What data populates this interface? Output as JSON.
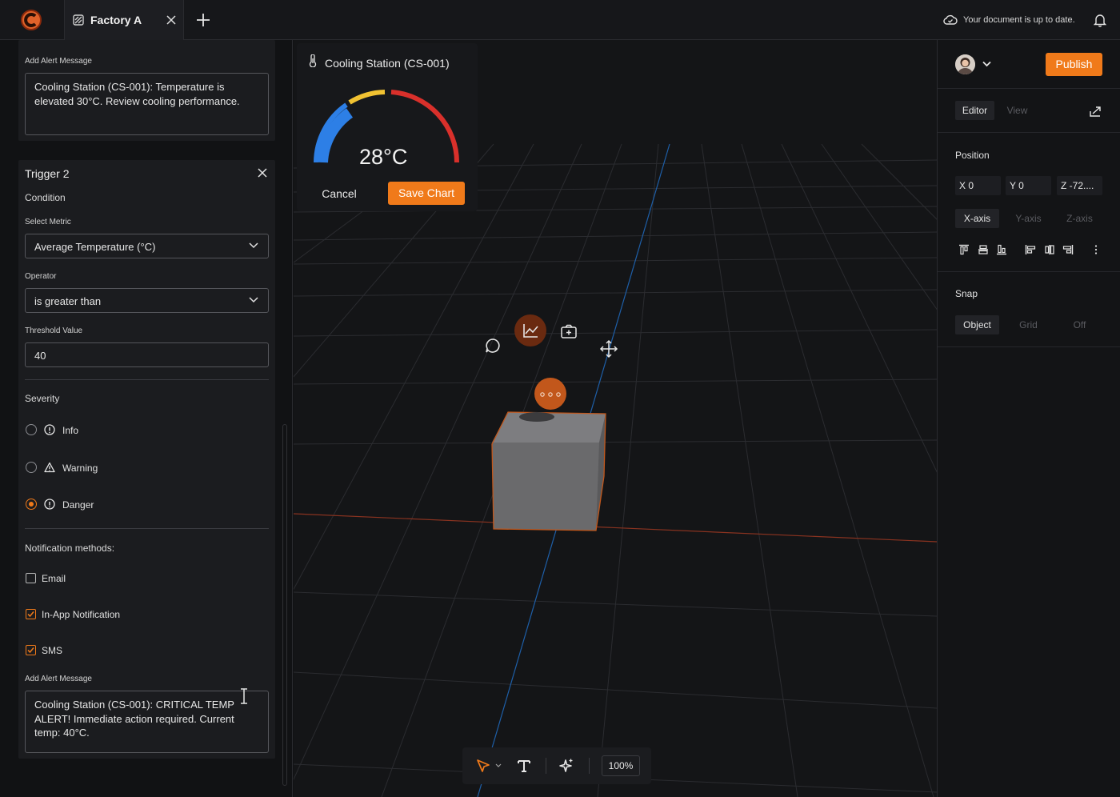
{
  "topbar": {
    "tab_title": "Factory A",
    "sync_status": "Your document is up to date."
  },
  "left": {
    "alert1": {
      "label": "Add Alert Message",
      "message": "Cooling Station (CS-001): Temperature is elevated 30°C. Review cooling performance."
    },
    "trigger": {
      "title": "Trigger 2",
      "condition_label": "Condition",
      "metric_label": "Select Metric",
      "metric_value": "Average Temperature (°C)",
      "operator_label": "Operator",
      "operator_value": "is greater than",
      "threshold_label": "Threshold Value",
      "threshold_value": "40",
      "severity_label": "Severity",
      "severity_options": [
        "Info",
        "Warning",
        "Danger"
      ],
      "severity_selected": "Danger",
      "notify_label": "Notification methods:",
      "notify_options": [
        {
          "label": "Email",
          "checked": false
        },
        {
          "label": "In-App Notification",
          "checked": true
        },
        {
          "label": "SMS",
          "checked": true
        }
      ],
      "alert_label": "Add Alert Message",
      "alert_message": "Cooling Station (CS-001): CRITICAL TEMP ALERT! Immediate action required. Current temp: 40°C."
    }
  },
  "viewport": {
    "chart_popup": {
      "title": "Cooling Station (CS-001)",
      "value": "28°C",
      "gauge_fraction": 0.28,
      "cancel_label": "Cancel",
      "save_label": "Save Chart"
    },
    "zoom": "100%"
  },
  "right": {
    "publish_label": "Publish",
    "modes": [
      "Editor",
      "View"
    ],
    "position_label": "Position",
    "position": {
      "x": "X 0",
      "y": "Y 0",
      "z": "Z -72...."
    },
    "axes": [
      "X-axis",
      "Y-axis",
      "Z-axis"
    ],
    "snap_label": "Snap",
    "snap_options": [
      "Object",
      "Grid",
      "Off"
    ]
  },
  "colors": {
    "accent": "#f07a1a",
    "gauge_blue": "#2d7fe6",
    "gauge_yellow": "#f1c232",
    "gauge_red": "#d9302b"
  }
}
